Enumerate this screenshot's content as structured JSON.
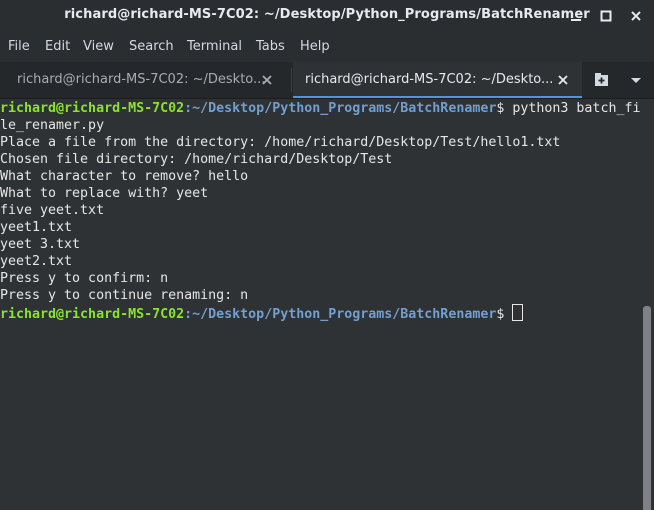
{
  "window": {
    "title": "richard@richard-MS-7C02: ~/Desktop/Python_Programs/BatchRenamer"
  },
  "menu": {
    "items": [
      "File",
      "Edit",
      "View",
      "Search",
      "Terminal",
      "Tabs",
      "Help"
    ]
  },
  "tabs": [
    {
      "label": "richard@richard-MS-7C02: ~/Deskto...",
      "active": false
    },
    {
      "label": "richard@richard-MS-7C02: ~/Deskto...",
      "active": true
    }
  ],
  "terminal": {
    "prompt_user": "richard@richard-MS-7C02",
    "prompt_sep": ":",
    "prompt_path": "~/Desktop/Python_Programs/BatchRenamer",
    "prompt_symbol": "$",
    "command_line1": " python3 batch_fi",
    "command_line2": "le_renamer.py",
    "output": [
      "Place a file from the directory: /home/richard/Desktop/Test/hello1.txt",
      "Chosen file directory: /home/richard/Desktop/Test",
      "What character to remove? hello",
      "What to replace with? yeet",
      "five yeet.txt",
      "yeet1.txt",
      "yeet 3.txt",
      "yeet2.txt",
      "Press y to confirm: n",
      "Press y to continue renaming: n"
    ]
  },
  "colors": {
    "prompt_user": "#8ae234",
    "prompt_path": "#729fcf",
    "active_tab_underline": "#5294e2"
  },
  "icons": {
    "minimize": "minimize-icon",
    "maximize": "maximize-icon",
    "close": "close-icon",
    "tab_close": "close-icon",
    "new_tab": "new-tab-icon",
    "tab_menu": "chevron-down-icon"
  }
}
